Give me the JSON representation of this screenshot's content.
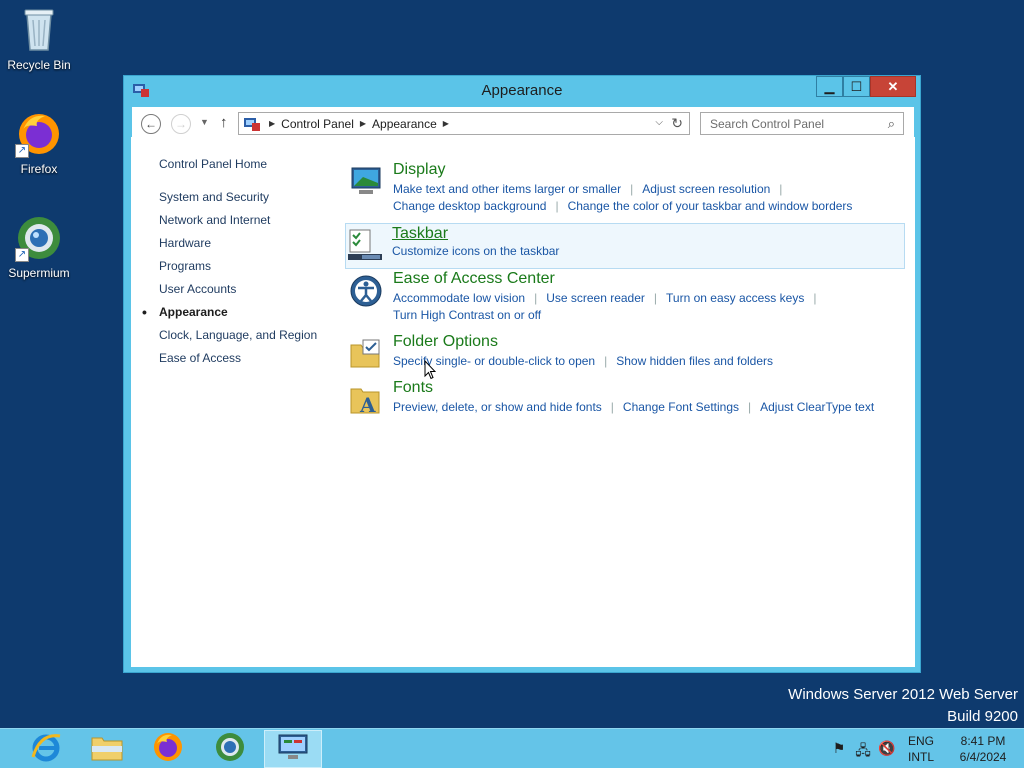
{
  "desktop": {
    "icons": [
      {
        "label": "Recycle Bin",
        "icon": "recycle-bin-icon"
      },
      {
        "label": "Firefox",
        "icon": "firefox-icon"
      },
      {
        "label": "Supermium",
        "icon": "supermium-icon"
      }
    ],
    "watermark": {
      "line1": "Windows Server 2012 Web Server",
      "line2": "Build 9200"
    }
  },
  "window": {
    "title": "Appearance",
    "controls": {
      "minimize": "▁",
      "maximize": "☐",
      "close": "✕"
    },
    "breadcrumb": [
      "Control Panel",
      "Appearance"
    ],
    "search": {
      "placeholder": "Search Control Panel"
    }
  },
  "left_nav": {
    "home": "Control Panel Home",
    "items": [
      "System and Security",
      "Network and Internet",
      "Hardware",
      "Programs",
      "User Accounts",
      "Appearance",
      "Clock, Language, and Region",
      "Ease of Access"
    ],
    "active_index": 5
  },
  "sections": [
    {
      "title": "Display",
      "icon": "display-icon",
      "links_row1": [
        "Make text and other items larger or smaller",
        "Adjust screen resolution"
      ],
      "links_row2": [
        "Change desktop background",
        "Change the color of your taskbar and window borders"
      ]
    },
    {
      "title": "Taskbar",
      "icon": "taskbar-icon",
      "links_row1": [
        "Customize icons on the taskbar"
      ]
    },
    {
      "title": "Ease of Access Center",
      "icon": "ease-of-access-icon",
      "links_row1": [
        "Accommodate low vision",
        "Use screen reader",
        "Turn on easy access keys"
      ],
      "links_row2": [
        "Turn High Contrast on or off"
      ]
    },
    {
      "title": "Folder Options",
      "icon": "folder-options-icon",
      "links_row1": [
        "Specify single- or double-click to open",
        "Show hidden files and folders"
      ]
    },
    {
      "title": "Fonts",
      "icon": "fonts-icon",
      "links_row1": [
        "Preview, delete, or show and hide fonts",
        "Change Font Settings",
        "Adjust ClearType text"
      ]
    }
  ],
  "taskbar": {
    "apps": [
      "internet-explorer-icon",
      "file-explorer-icon",
      "firefox-icon",
      "supermium-icon",
      "control-panel-icon"
    ],
    "tray": {
      "lang1": "ENG",
      "lang2": "INTL",
      "time": "8:41 PM",
      "date": "6/4/2024"
    }
  },
  "colors": {
    "desktop": "#0e3a6e",
    "window_frame": "#5bc4e8",
    "taskbar": "#64c4e8",
    "heading_green": "#1a7a1a",
    "link_blue": "#1a56a5",
    "close_red": "#c74437"
  }
}
